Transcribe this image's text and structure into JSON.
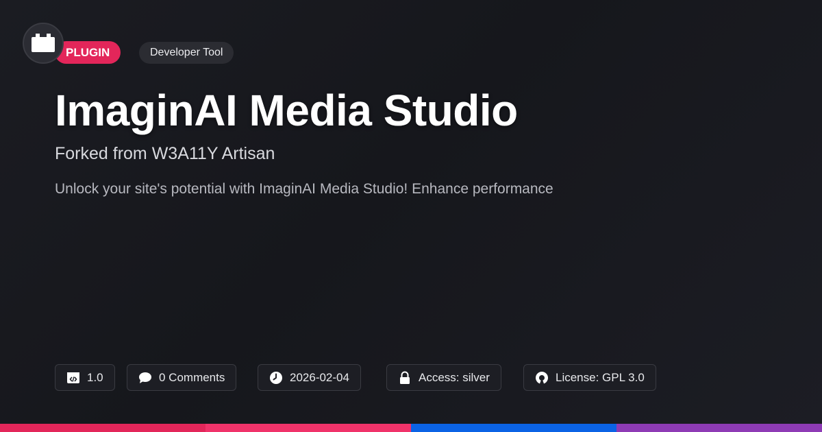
{
  "badges": {
    "type_label": "PLUGIN",
    "category_label": "Developer Tool"
  },
  "hero": {
    "title": "ImaginAI Media Studio",
    "subtitle": "Forked from W3A11Y Artisan",
    "description": "Unlock your site's potential with ImaginAI Media Studio! Enhance performance"
  },
  "meta": {
    "version": "1.0",
    "comments": "0 Comments",
    "date": "2026-02-04",
    "access": "Access: silver",
    "license": "License: GPL 3.0"
  },
  "icons": [
    "plugin-logo-icon",
    "code-window-icon",
    "comment-icon",
    "clock-icon",
    "lock-icon",
    "open-source-icon"
  ],
  "colors": {
    "accent_pink": "#e3265a",
    "bar_1": "#e3265a",
    "bar_2": "#f0336a",
    "bar_3": "#0b63e5",
    "bar_4": "#8e3bb5",
    "background": "#16171c"
  }
}
